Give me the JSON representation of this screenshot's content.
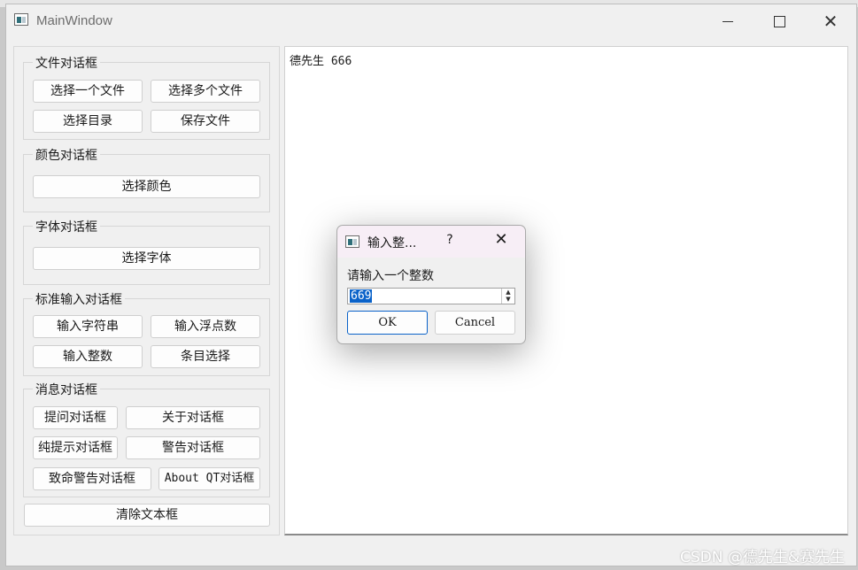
{
  "window": {
    "title": "MainWindow",
    "minimize_glyph": "—",
    "close_glyph": "✕"
  },
  "groups": {
    "file": {
      "title": "文件对话框",
      "open_one": "选择一个文件",
      "open_many": "选择多个文件",
      "open_dir": "选择目录",
      "save": "保存文件"
    },
    "color": {
      "title": "颜色对话框",
      "select": "选择颜色"
    },
    "font": {
      "title": "字体对话框",
      "select": "选择字体"
    },
    "input": {
      "title": "标准输入对话框",
      "string": "输入字符串",
      "double": "输入浮点数",
      "int": "输入整数",
      "item": "条目选择"
    },
    "message": {
      "title": "消息对话框",
      "question": "提问对话框",
      "about": "关于对话框",
      "info": "纯提示对话框",
      "warning": "警告对话框",
      "critical": "致命警告对话框",
      "about_qt": "About QT对话框"
    }
  },
  "clear_button": "清除文本框",
  "text_edit": {
    "content": "德先生 666"
  },
  "dialog": {
    "title": "输入整...",
    "help": "?",
    "close": "✕",
    "label": "请输入一个整数",
    "value": "669",
    "ok": "OK",
    "cancel": "Cancel"
  },
  "watermark": "CSDN @德先生&赛先生",
  "colors": {
    "accent": "#0a62c9",
    "window_bg": "#f0f0f0",
    "dialog_title_bg": "#f7eef6"
  }
}
